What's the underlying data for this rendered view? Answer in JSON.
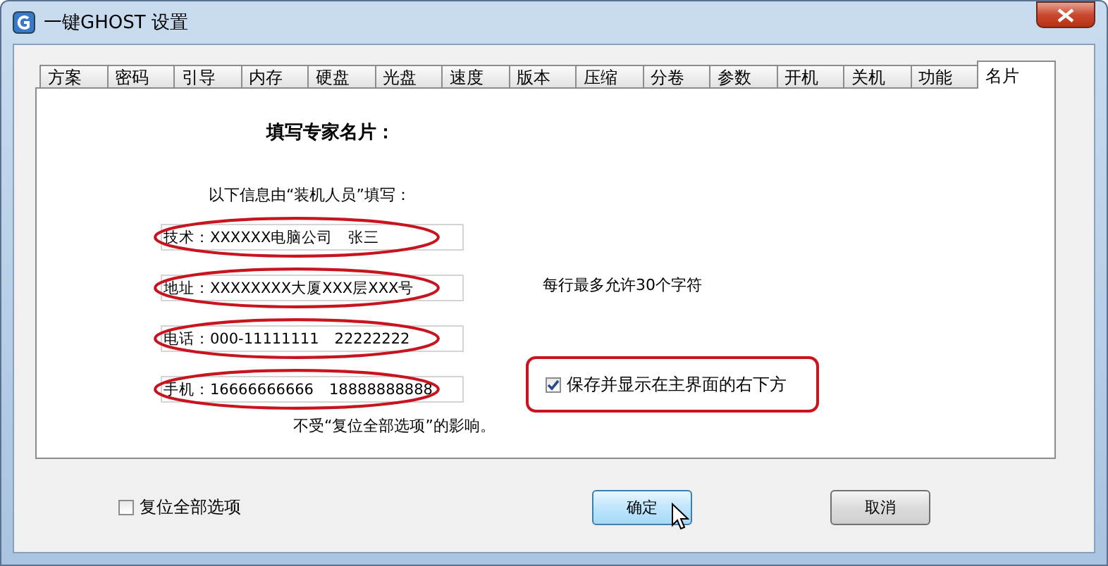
{
  "window": {
    "title": "一键GHOST 设置"
  },
  "tabs": [
    {
      "label": "方案",
      "selected": false
    },
    {
      "label": "密码",
      "selected": false
    },
    {
      "label": "引导",
      "selected": false
    },
    {
      "label": "内存",
      "selected": false
    },
    {
      "label": "硬盘",
      "selected": false
    },
    {
      "label": "光盘",
      "selected": false
    },
    {
      "label": "速度",
      "selected": false
    },
    {
      "label": "版本",
      "selected": false
    },
    {
      "label": "压缩",
      "selected": false
    },
    {
      "label": "分卷",
      "selected": false
    },
    {
      "label": "参数",
      "selected": false
    },
    {
      "label": "开机",
      "selected": false
    },
    {
      "label": "关机",
      "selected": false
    },
    {
      "label": "功能",
      "selected": false
    },
    {
      "label": "名片",
      "selected": true
    }
  ],
  "panel": {
    "heading": "填写专家名片：",
    "intro": "以下信息由“装机人员”填写：",
    "hint": "每行最多允许30个字符",
    "fields": [
      {
        "value": "技术：XXXXXX电脑公司　张三",
        "highlighted": true
      },
      {
        "value": "地址：XXXXXXXX大厦XXX层XXX号",
        "highlighted": true
      },
      {
        "value": "电话：000-11111111　22222222",
        "highlighted": true
      },
      {
        "value": "手机：16666666666　18888888888",
        "highlighted": true
      }
    ],
    "show_option": {
      "label": "保存并显示在主界面的右下方",
      "checked": true,
      "highlighted": true
    },
    "note": "不受“复位全部选项”的影响。"
  },
  "reset_option": {
    "label": "复位全部选项",
    "checked": false
  },
  "buttons": [
    {
      "label": "确定",
      "kind": "default"
    },
    {
      "label": "取消",
      "kind": "normal"
    }
  ]
}
